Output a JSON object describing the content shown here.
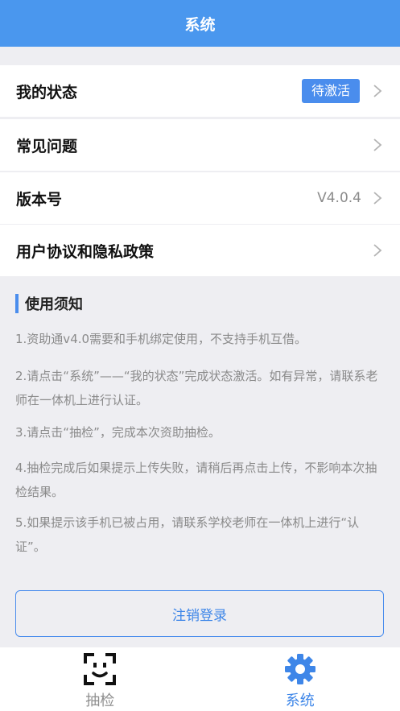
{
  "header": {
    "title": "系统"
  },
  "menu": {
    "status": {
      "label": "我的状态",
      "badge": "待激活"
    },
    "faq": {
      "label": "常见问题"
    },
    "version": {
      "label": "版本号",
      "value": "V4.0.4"
    },
    "policy": {
      "label": "用户协议和隐私政策"
    }
  },
  "notice": {
    "title": "使用须知",
    "items": [
      "1.资助通v4.0需要和手机绑定使用，不支持手机互借。",
      "2.请点击“系统”——“我的状态”完成状态激活。如有异常，请联系老师在一体机上进行认证。",
      "3.请点击“抽检”，完成本次资助抽检。",
      "4.抽检完成后如果提示上传失败，请稍后再点击上传，不影响本次抽检结果。",
      "5.如果提示该手机已被占用，请联系学校老师在一体机上进行“认证”。"
    ]
  },
  "logout": {
    "label": "注销登录"
  },
  "tabbar": {
    "tabs": [
      {
        "label": "抽检",
        "icon": "face-scan-icon"
      },
      {
        "label": "系统",
        "icon": "gear-icon"
      }
    ]
  },
  "colors": {
    "primary": "#4a97ee",
    "accent": "#3e86e8",
    "background": "#eeeef2"
  }
}
